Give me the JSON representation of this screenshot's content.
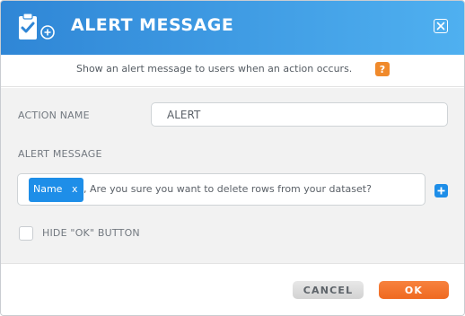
{
  "dialog": {
    "title": "ALERT MESSAGE",
    "header_icon": "clipboard-check-add-icon",
    "close_icon": "close-icon",
    "accent_color": "#2f86d6",
    "primary_color": "#ef6920"
  },
  "description": {
    "text": "Show an alert message to users when an action occurs.",
    "help_label": "?"
  },
  "form": {
    "action_name_label": "ACTION NAME",
    "action_name_value": "ALERT",
    "alert_message_label": "ALERT MESSAGE",
    "chip_label": "Name",
    "chip_remove": "x",
    "message_text": ", Are you sure you want to delete rows from your dataset?",
    "add_icon": "plus-icon",
    "hide_ok_label": "HIDE \"OK\" BUTTON",
    "hide_ok_checked": false
  },
  "footer": {
    "cancel_label": "CANCEL",
    "ok_label": "OK"
  }
}
